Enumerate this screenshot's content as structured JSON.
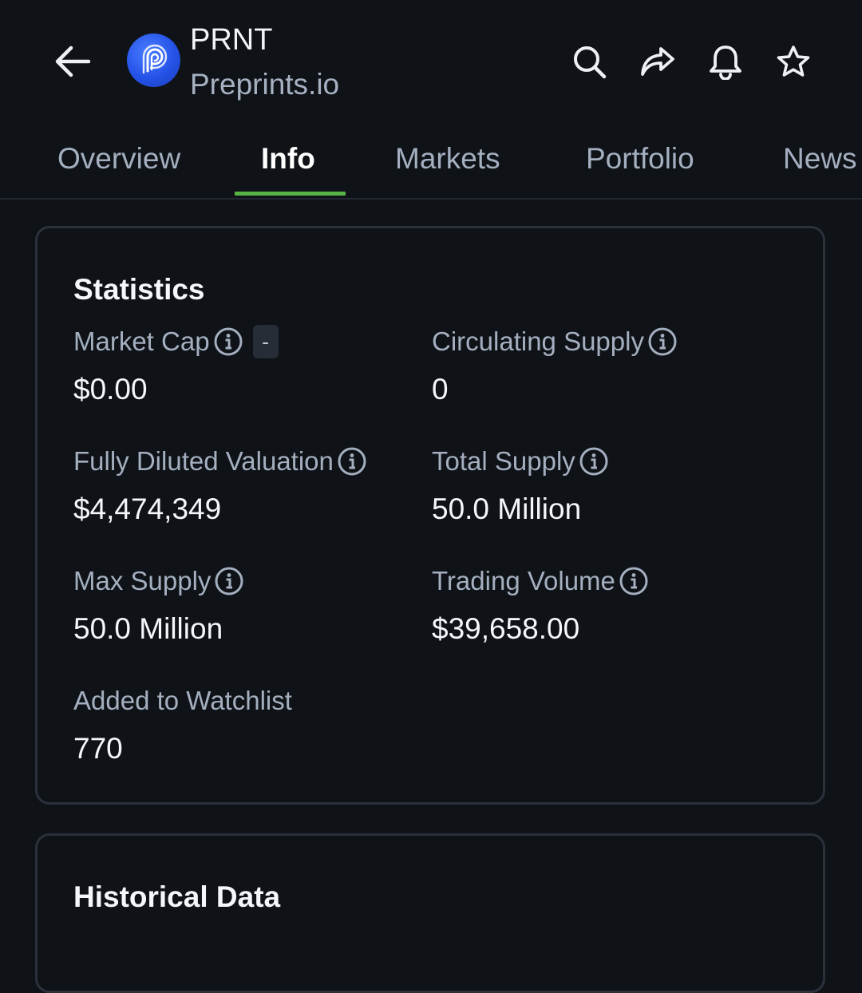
{
  "header": {
    "ticker": "PRNT",
    "name": "Preprints.io",
    "back_icon": "arrow-left-icon",
    "logo_icon": "preprints-logo-icon",
    "actions": [
      "search-icon",
      "share-icon",
      "bell-icon",
      "star-icon"
    ]
  },
  "tabs": [
    {
      "label": "Overview",
      "active": false
    },
    {
      "label": "Info",
      "active": true
    },
    {
      "label": "Markets",
      "active": false
    },
    {
      "label": "Portfolio",
      "active": false
    },
    {
      "label": "News",
      "active": false
    }
  ],
  "statistics": {
    "title": "Statistics",
    "items": [
      {
        "label": "Market Cap",
        "value": "$0.00",
        "badge": "-"
      },
      {
        "label": "Circulating Supply",
        "value": "0"
      },
      {
        "label": "Fully Diluted Valuation",
        "value": "$4,474,349"
      },
      {
        "label": "Total Supply",
        "value": "50.0 Million"
      },
      {
        "label": "Max Supply",
        "value": "50.0 Million"
      },
      {
        "label": "Trading Volume",
        "value": "$39,658.00"
      },
      {
        "label": "Added to Watchlist",
        "value": "770"
      }
    ]
  },
  "historical": {
    "title": "Historical Data"
  },
  "colors": {
    "background": "#0f1217",
    "accent": "#56b544",
    "muted_text": "#a4afbf",
    "card_border": "#2a313b"
  }
}
